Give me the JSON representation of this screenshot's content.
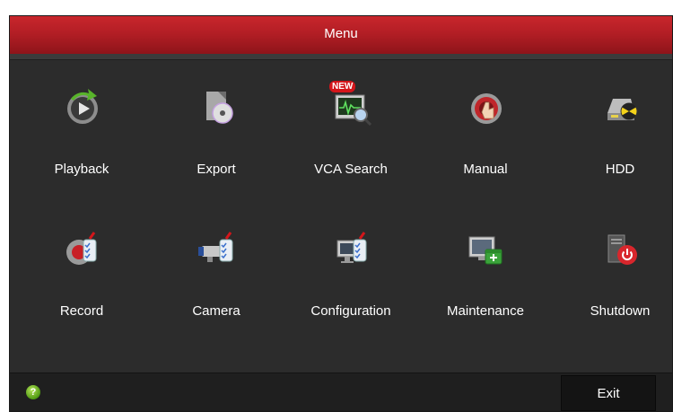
{
  "window": {
    "title": "Menu"
  },
  "menu": {
    "items": [
      {
        "label": "Playback",
        "icon": "playback-icon"
      },
      {
        "label": "Export",
        "icon": "export-icon"
      },
      {
        "label": "VCA Search",
        "icon": "vca-search-icon",
        "badge": "NEW"
      },
      {
        "label": "Manual",
        "icon": "manual-icon"
      },
      {
        "label": "HDD",
        "icon": "hdd-icon"
      },
      {
        "label": "Record",
        "icon": "record-icon"
      },
      {
        "label": "Camera",
        "icon": "camera-icon"
      },
      {
        "label": "Configuration",
        "icon": "configuration-icon"
      },
      {
        "label": "Maintenance",
        "icon": "maintenance-icon"
      },
      {
        "label": "Shutdown",
        "icon": "shutdown-icon"
      }
    ]
  },
  "footer": {
    "help": "?",
    "exit_label": "Exit"
  },
  "colors": {
    "titlebar": "#b31e25",
    "background": "#2c2c2c",
    "footer": "#1f1f1f",
    "help": "#6fb324"
  }
}
